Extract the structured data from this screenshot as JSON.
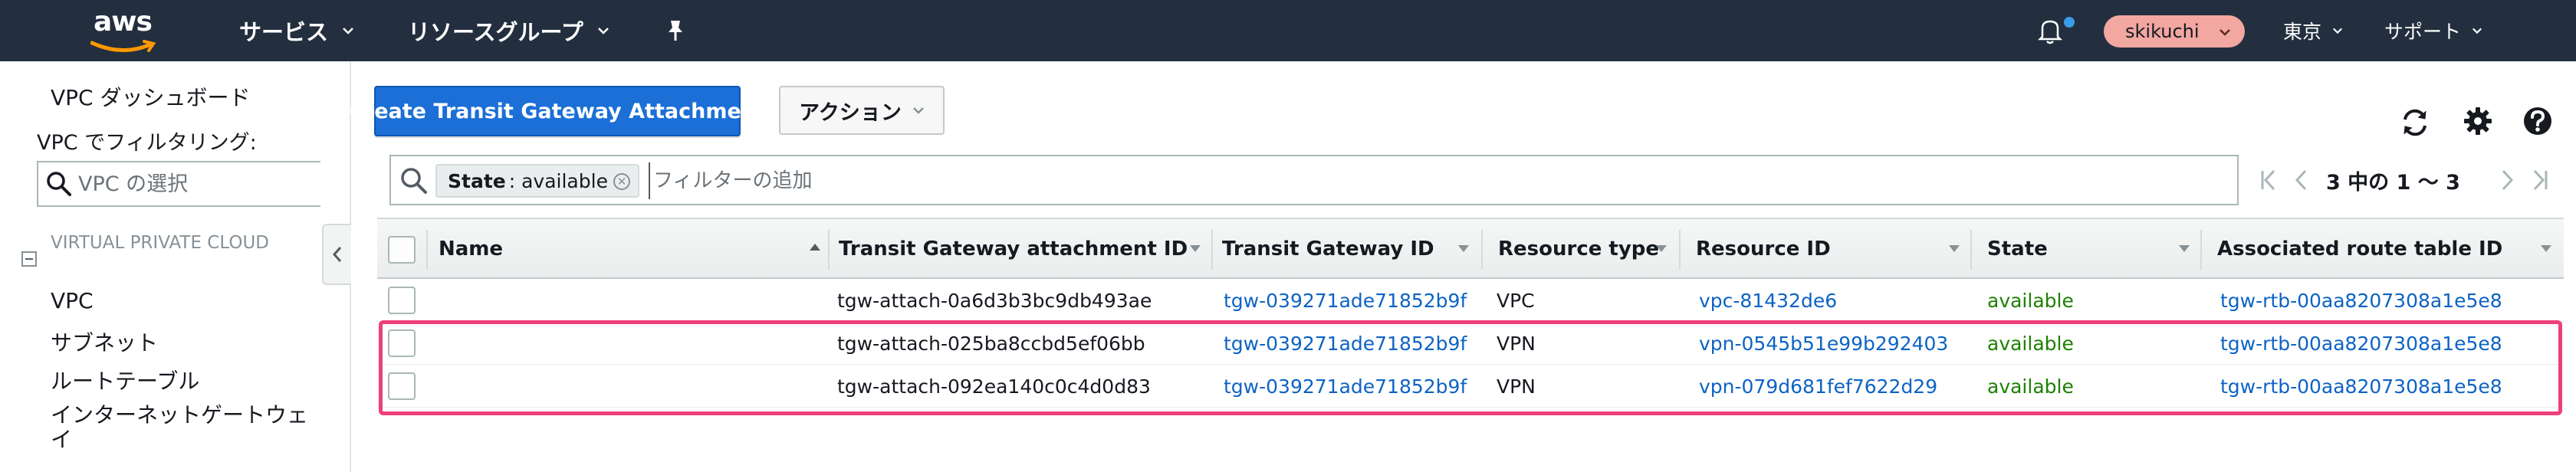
{
  "nav": {
    "logo_text": "aws",
    "services": "サービス",
    "resource_groups": "リソースグループ",
    "user": "skikuchi",
    "region": "東京",
    "support": "サポート"
  },
  "sidebar": {
    "dashboard": "VPC ダッシュボード",
    "filter_label": "VPC でフィルタリング:",
    "search_placeholder": "VPC の選択",
    "section_title": "VIRTUAL PRIVATE CLOUD",
    "items": [
      "VPC",
      "サブネット",
      "ルートテーブル",
      "インターネットゲートウェイ"
    ]
  },
  "toolbar": {
    "create_label": "Create Transit Gateway Attachment",
    "action_label": "アクション"
  },
  "filter": {
    "token_key": "State",
    "token_value": ": available",
    "placeholder": "フィルターの追加"
  },
  "pager": {
    "text": "3 中の 1 ～ 3"
  },
  "table": {
    "columns": [
      "Name",
      "Transit Gateway attachment ID",
      "Transit Gateway ID",
      "Resource type",
      "Resource ID",
      "State",
      "Associated route table ID"
    ],
    "rows": [
      {
        "name": "",
        "attachment_id": "tgw-attach-0a6d3b3bc9db493ae",
        "tgw_id": "tgw-039271ade71852b9f",
        "resource_type": "VPC",
        "resource_id": "vpc-81432de6",
        "state": "available",
        "route_table": "tgw-rtb-00aa8207308a1e5e8"
      },
      {
        "name": "",
        "attachment_id": "tgw-attach-025ba8ccbd5ef06bb",
        "tgw_id": "tgw-039271ade71852b9f",
        "resource_type": "VPN",
        "resource_id": "vpn-0545b51e99b292403",
        "state": "available",
        "route_table": "tgw-rtb-00aa8207308a1e5e8"
      },
      {
        "name": "",
        "attachment_id": "tgw-attach-092ea140c0c4d0d83",
        "tgw_id": "tgw-039271ade71852b9f",
        "resource_type": "VPN",
        "resource_id": "vpn-079d681fef7622d29",
        "state": "available",
        "route_table": "tgw-rtb-00aa8207308a1e5e8"
      }
    ]
  },
  "colors": {
    "nav_bg": "#232f3e",
    "primary": "#1b6fd6",
    "link": "#0d63c4",
    "available": "#1d8102",
    "highlight": "#ec407a",
    "user_pill": "#f2a7a1"
  },
  "icons": [
    "aws-logo",
    "search-icon",
    "bell-icon",
    "pin-icon",
    "refresh-icon",
    "gear-icon",
    "help-icon",
    "chevron-left-icon",
    "caret-down-icon"
  ]
}
